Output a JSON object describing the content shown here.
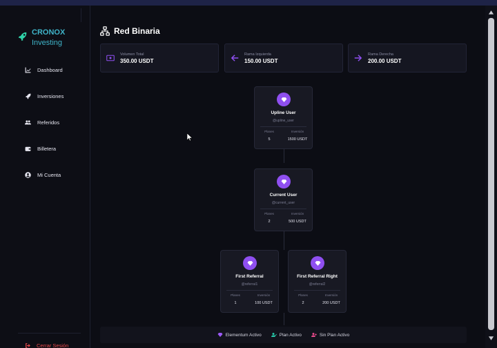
{
  "brand": {
    "name": "CRONOX",
    "sub": "Investing"
  },
  "sidebar": {
    "items": [
      {
        "label": "Dashboard",
        "icon": "chart-line-icon"
      },
      {
        "label": "Inversiones",
        "icon": "rocket-icon"
      },
      {
        "label": "Referidos",
        "icon": "users-icon"
      },
      {
        "label": "Billetera",
        "icon": "wallet-icon"
      },
      {
        "label": "Mi Cuenta",
        "icon": "user-circle-icon"
      }
    ],
    "logout": "Cerrar Sesión"
  },
  "page": {
    "title": "Red Binaria"
  },
  "stats": [
    {
      "label": "Volumen Total",
      "value": "350.00 USDT",
      "icon": "money-icon"
    },
    {
      "label": "Rama Izquierda",
      "value": "150.00 USDT",
      "icon": "arrow-left-icon"
    },
    {
      "label": "Rama Derecha",
      "value": "200.00 USDT",
      "icon": "arrow-right-icon"
    }
  ],
  "nodes": {
    "upline": {
      "name": "Upline User",
      "handle": "@upline_user",
      "planes_label": "Planes",
      "planes": "5",
      "inv_label": "Inversión",
      "inversion": "1500 USDT"
    },
    "current": {
      "name": "Current User",
      "handle": "@current_user",
      "planes_label": "Planes",
      "planes": "2",
      "inv_label": "Inversión",
      "inversion": "500 USDT"
    },
    "left": {
      "name": "First Referral",
      "handle": "@referral1",
      "planes_label": "Planes",
      "planes": "1",
      "inv_label": "Inversión",
      "inversion": "100 USDT"
    },
    "right": {
      "name": "First Referral Right",
      "handle": "@referral2",
      "planes_label": "Planes",
      "planes": "2",
      "inv_label": "Inversión",
      "inversion": "200 USDT"
    }
  },
  "legend": [
    {
      "label": "Elementum Activo",
      "color": "#9b59f5",
      "icon": "gem-icon"
    },
    {
      "label": "Plan Activo",
      "color": "#27c7a8",
      "icon": "user-check-icon"
    },
    {
      "label": "Sin Plan Activo",
      "color": "#e84a8a",
      "icon": "user-plus-icon"
    }
  ],
  "colors": {
    "accent": "#8f4ff0",
    "brand": "#3fb4c9",
    "danger": "#e8484a"
  }
}
